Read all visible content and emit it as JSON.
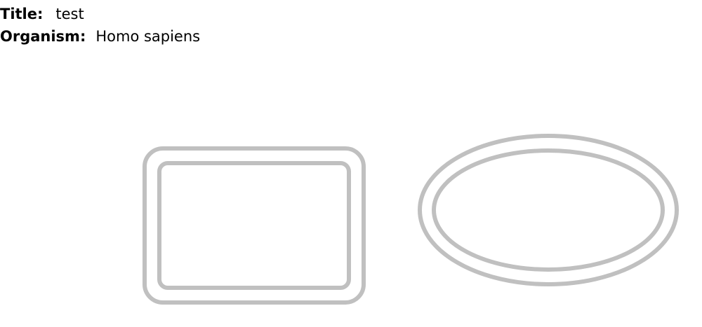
{
  "info": {
    "title_label": "Title:",
    "title_value": "test",
    "organism_label": "Organism:",
    "organism_value": "Homo sapiens"
  },
  "shapes": [
    {
      "name": "rounded-rectangle-node",
      "kind": "rounded-rectangle",
      "border": "double"
    },
    {
      "name": "ellipse-node",
      "kind": "ellipse",
      "border": "double"
    }
  ],
  "colors": {
    "shape_stroke": "#c0c0c0",
    "background": "#ffffff",
    "text": "#000000"
  }
}
